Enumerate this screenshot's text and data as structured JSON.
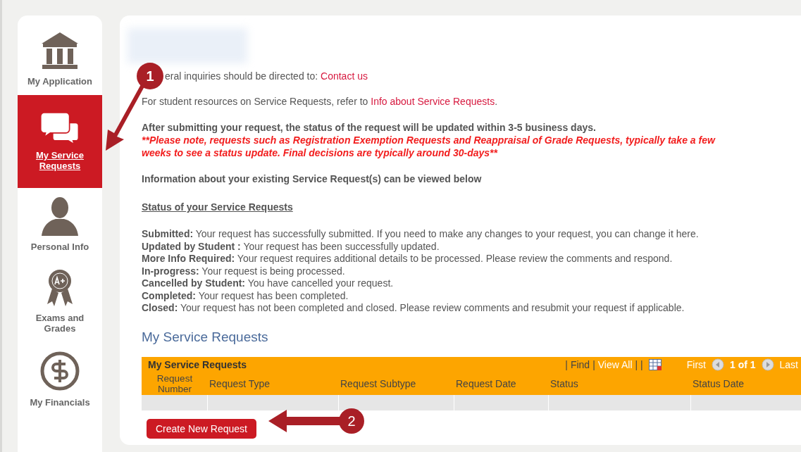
{
  "sidebar": {
    "items": [
      {
        "label": "My Application",
        "selected": false
      },
      {
        "label": "My Service Requests",
        "selected": true
      },
      {
        "label": "Personal Info",
        "selected": false
      },
      {
        "label": "Exams and Grades",
        "selected": false
      },
      {
        "label": "My Financials",
        "selected": false
      }
    ]
  },
  "intro": [
    {
      "text": "eral inquiries should be directed to: ",
      "link": "Contact us"
    },
    {
      "text": "For student resources on Service Requests, refer to ",
      "link": "Info about Service Requests",
      "after": "."
    }
  ],
  "notice": {
    "bold": "After submitting your request, the status of the request will be updated within 3-5 business days.",
    "warning": "**Please note, requests such as Registration Exemption Requests and Reappraisal of Grade Requests, typically take a few weeks to see a status update. Final decisions are typically around 30-days**"
  },
  "info_heading": "Information about your existing Service Request(s) can be viewed below",
  "status_heading": "Status of your Service Requests",
  "statuses": [
    "**Submitted:** Your request has successfully submitted. If you need to make any changes to your request, you can change it here.",
    "**Updated by Student :** Your request has been successfully updated.",
    "**More Info Required:** Your request requires additional details to be processed. Please review the comments and respond.",
    "**In-progress:** Your request is being processed.",
    "**Cancelled by Student:** You have cancelled your request.",
    "**Completed:** Your request has been completed.",
    "**Closed:** Your request has not been completed and closed. Please review comments and resubmit your request if applicable."
  ],
  "section_title": "My Service Requests",
  "grid": {
    "title": "My Service Requests",
    "separators": [
      "|",
      "|",
      "| |"
    ],
    "find": "Find",
    "view_all": "View All",
    "first": "First",
    "page": "1 of 1",
    "last": "Last",
    "columns": [
      "Request Number",
      "Request Type",
      "Request Subtype",
      "Request Date",
      "Status",
      "Status Date"
    ]
  },
  "create_button": "Create New Request",
  "callouts": [
    "1",
    "2"
  ]
}
